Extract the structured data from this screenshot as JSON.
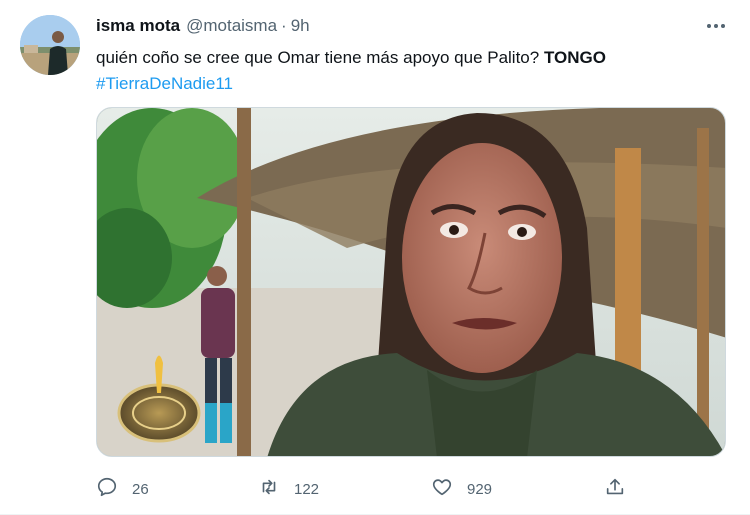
{
  "tweet": {
    "author_name": "isma mota",
    "author_handle": "@motaisma",
    "separator": "·",
    "time": "9h",
    "more_label": "•••",
    "text_main": "quién coño se cree que Omar tiene más apoyo que Palito? ",
    "text_bold": "TONGO",
    "hashtag": "#TierraDeNadie11"
  },
  "actions": {
    "replies": "26",
    "retweets": "122",
    "likes": "929"
  },
  "icons": {
    "reply": "reply-icon",
    "retweet": "retweet-icon",
    "like": "like-icon",
    "share": "share-icon",
    "more": "more-icon"
  },
  "colors": {
    "link": "#1d9bf0",
    "secondary_text": "#536471",
    "primary_text": "#0f1419"
  }
}
